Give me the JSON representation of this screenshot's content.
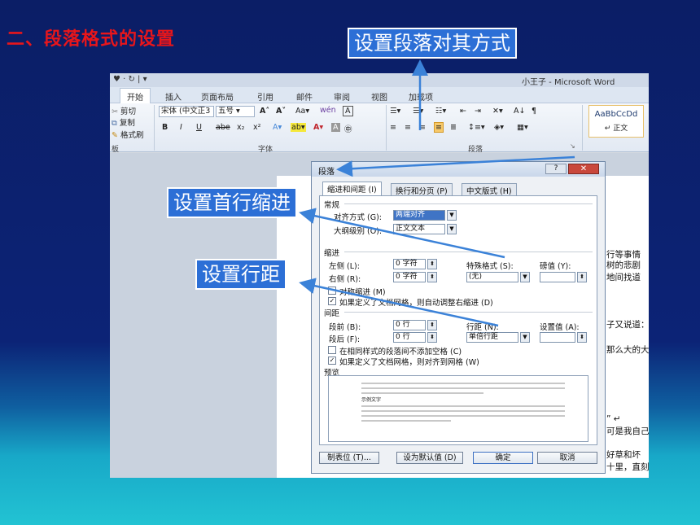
{
  "slide": {
    "title": "二、段落格式的设置",
    "callouts": {
      "alignment": "设置段落对其方式",
      "first_indent": "设置首行缩进",
      "line_spacing": "设置行距"
    },
    "colors": {
      "title": "#e8161b",
      "callout_bg": "#2c6fd6",
      "arrow": "#3b82d8"
    }
  },
  "word": {
    "quick_access": "♥ · ↻ | ▾",
    "window_title": "小王子 - Microsoft Word",
    "tabs": [
      "开始",
      "插入",
      "页面布局",
      "引用",
      "邮件",
      "审阅",
      "视图",
      "加载项"
    ],
    "clipboard": {
      "cut": "剪切",
      "copy": "复制",
      "painter": "格式刷",
      "label": "板"
    },
    "font": {
      "name": "宋体 (中文正3",
      "size": "五号",
      "grow": "A˄",
      "shrink": "A˅",
      "case": "Aa▾",
      "clear": "wén",
      "phonetic": "A",
      "bold": "B",
      "italic": "I",
      "underline": "U",
      "strike": "abe",
      "sub": "x₂",
      "sup": "x²",
      "label": "字体"
    },
    "paragraph": {
      "label": "段落"
    },
    "styles": {
      "preview": "AaBbCcDd",
      "name": "↵ 正文"
    },
    "page_lines": [
      "行等事情",
      "树的悲剧",
      "地间找道",
      "子又说道：",
      "那么大的大",
      "” ↵",
      "可是我自己",
      "好草和坏",
      "十里，直刻"
    ]
  },
  "dialog": {
    "title": "段落",
    "help": "?",
    "close": "✕",
    "tabs": [
      "缩进和间距 (I)",
      "换行和分页 (P)",
      "中文版式 (H)"
    ],
    "general": {
      "heading": "常规",
      "alignment_label": "对齐方式 (G):",
      "alignment_value": "两端对齐",
      "outline_label": "大纲级别 (O):",
      "outline_value": "正文文本"
    },
    "indent": {
      "heading": "缩进",
      "left_label": "左侧 (L):",
      "left_value": "0 字符",
      "right_label": "右侧 (R):",
      "right_value": "0 字符",
      "special_label": "特殊格式 (S):",
      "special_value": "(无)",
      "by_label": "磅值 (Y):",
      "mirror": "对称缩进 (M)",
      "auto_adjust": "如果定义了文档网格，则自动调整右缩进 (D)"
    },
    "spacing": {
      "heading": "间距",
      "before_label": "段前 (B):",
      "before_value": "0 行",
      "after_label": "段后 (F):",
      "after_value": "0 行",
      "line_label": "行距 (N):",
      "line_value": "单倍行距",
      "at_label": "设置值 (A):",
      "no_space": "在相同样式的段落间不添加空格 (C)",
      "snap_grid": "如果定义了文档网格，则对齐到网格 (W)"
    },
    "preview": {
      "heading": "预览",
      "sample": "示例文字"
    },
    "buttons": {
      "tabs": "制表位 (T)...",
      "default": "设为默认值 (D)",
      "ok": "确定",
      "cancel": "取消"
    }
  }
}
